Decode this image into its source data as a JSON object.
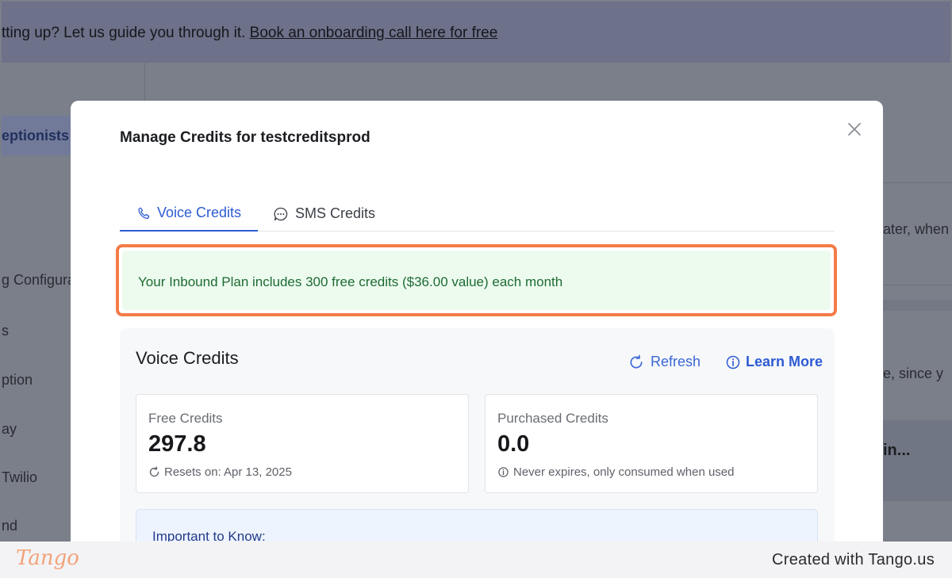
{
  "banner": {
    "text": "tting up? Let us guide you through it. ",
    "link": "Book an onboarding call here for free"
  },
  "sidebar": {
    "active_item": "eptionists",
    "items": [
      "g Configura",
      "s",
      "ption",
      "ay",
      "Twilio",
      "nd"
    ]
  },
  "background": {
    "right_text_1": "ater, when",
    "right_text_2": "e, since y",
    "right_text_3": "in..."
  },
  "modal": {
    "title": "Manage Credits for testcreditsprod",
    "tabs": [
      {
        "label": "Voice Credits",
        "icon": "phone-icon",
        "active": true
      },
      {
        "label": "SMS Credits",
        "icon": "chat-bubble-icon",
        "active": false
      }
    ],
    "notice": "Your Inbound Plan includes 300 free credits ($36.00 value) each month",
    "panel": {
      "title": "Voice Credits",
      "refresh_label": "Refresh",
      "learn_more_label": "Learn More",
      "free": {
        "label": "Free Credits",
        "value": "297.8",
        "meta": "Resets on: Apr 13, 2025"
      },
      "purchased": {
        "label": "Purchased Credits",
        "value": "0.0",
        "meta": "Never expires, only consumed when used"
      },
      "important_title": "Important to Know:"
    }
  },
  "footer": {
    "logo": "Tango",
    "text": "Created with Tango.us"
  },
  "colors": {
    "accent": "#2d5bd3",
    "highlight_border": "#f47c48",
    "notice_bg": "#edfbef",
    "notice_text": "#1e6b33"
  }
}
